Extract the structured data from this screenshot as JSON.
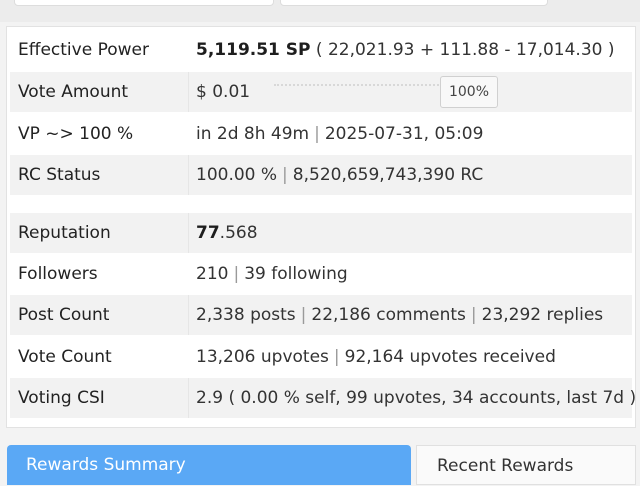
{
  "stats": [
    {
      "label": "Effective Power",
      "value_bold": "5,119.51 SP",
      "value": " ( 22,021.93 + 111.88 - 17,014.30 )"
    },
    {
      "label": "Vote Amount",
      "value": "$ 0.01",
      "percent": "100%"
    },
    {
      "label": "VP ~> 100 %",
      "parts": [
        "in 2d 8h 49m",
        "2025-07-31, 05:09"
      ]
    },
    {
      "label": "RC Status",
      "parts": [
        "100.00 %",
        "8,520,659,743,390 RC"
      ]
    }
  ],
  "profile": [
    {
      "label": "Reputation",
      "value_bold": "77",
      "value": ".568"
    },
    {
      "label": "Followers",
      "parts": [
        "210",
        "39 following"
      ]
    },
    {
      "label": "Post Count",
      "parts": [
        "2,338 posts",
        "22,186 comments",
        "23,292 replies"
      ]
    },
    {
      "label": "Vote Count",
      "parts": [
        "13,206 upvotes",
        "92,164 upvotes received"
      ]
    },
    {
      "label": "Voting CSI",
      "value": "2.9 ( 0.00 % self, 99 upvotes, 34 accounts, last 7d )"
    }
  ],
  "tabs": {
    "active": "Rewards Summary",
    "other": "Recent Rewards"
  },
  "colors": {
    "accent": "#5aa8f5",
    "row_alt": "#f2f2f2",
    "separator": "#9a9a9a"
  }
}
